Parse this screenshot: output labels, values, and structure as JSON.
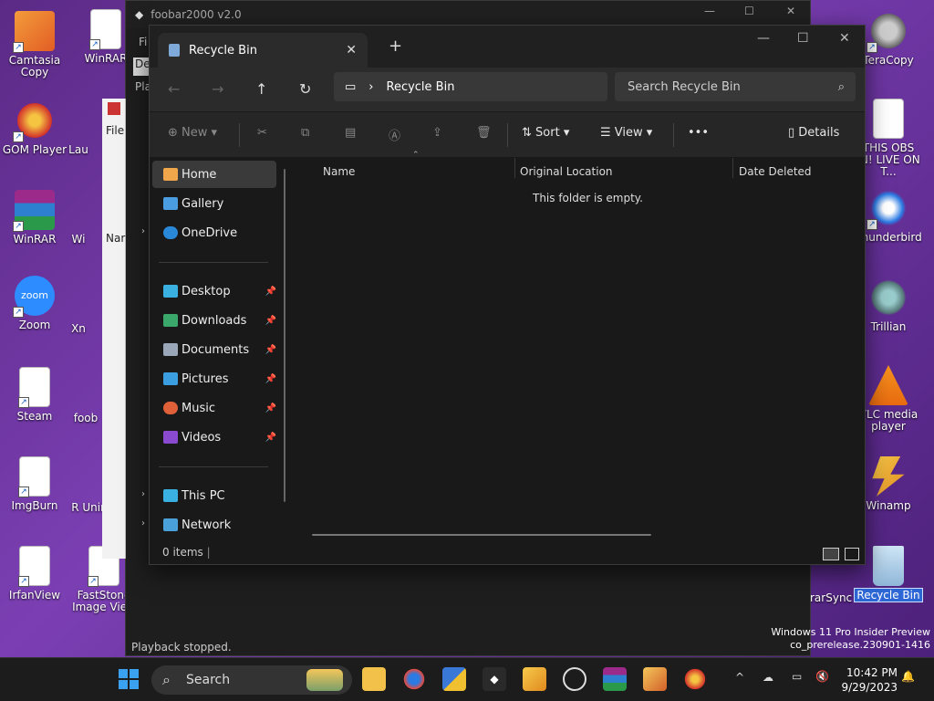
{
  "desktop": {
    "left_icons": [
      {
        "label": "Camtasia Copy",
        "icon": "camtasia-icon"
      },
      {
        "label": "GOM Player",
        "icon": "eye-icon"
      },
      {
        "label": "WinRAR",
        "icon": "winrar-icon"
      },
      {
        "label": "Zoom",
        "icon": "zoom-icon"
      },
      {
        "label": "Steam",
        "icon": "document-icon"
      },
      {
        "label": "ImgBurn",
        "icon": "document-icon"
      },
      {
        "label": "IrfanView",
        "icon": "document-icon"
      }
    ],
    "col2_icons": [
      {
        "label": "WinRAR"
      },
      {
        "label": "Lau"
      },
      {
        "label": "Wi"
      },
      {
        "label": "Xn"
      },
      {
        "label": "foob"
      },
      {
        "label": "R Unin"
      },
      {
        "label": "FastStone Image View"
      }
    ],
    "right_icons": [
      {
        "label": "TeraCopy",
        "icon": "teracopy-icon"
      },
      {
        "label": "THIS OBS IN! LIVE ON T...",
        "icon": "document-icon"
      },
      {
        "label": "Thunderbird",
        "icon": "thunderbird-icon"
      },
      {
        "label": "Trillian",
        "icon": "trillian-icon"
      },
      {
        "label": "VLC media player",
        "icon": "vlc-icon"
      },
      {
        "label": "Winamp",
        "icon": "winamp-icon"
      },
      {
        "label": "Recycle Bin",
        "icon": "recycle-bin-icon"
      }
    ],
    "partial_right": "rarSync",
    "watermark_line1": "Windows 11 Pro Insider Preview",
    "watermark_line2": "co_prerelease.230901-1416"
  },
  "foobar": {
    "title": "foobar2000 v2.0",
    "menu_partial": "Fi",
    "tab_partial": "Def",
    "pl_partial": "Pla",
    "status": "Playback stopped."
  },
  "explorer": {
    "tab_title": "Recycle Bin",
    "breadcrumb": "Recycle Bin",
    "search_placeholder": "Search Recycle Bin",
    "toolbar": {
      "new": "New",
      "sort": "Sort",
      "view": "View",
      "more": "•••",
      "details": "Details"
    },
    "nav": {
      "home": "Home",
      "gallery": "Gallery",
      "onedrive": "OneDrive",
      "desktop": "Desktop",
      "downloads": "Downloads",
      "documents": "Documents",
      "pictures": "Pictures",
      "music": "Music",
      "videos": "Videos",
      "thispc": "This PC",
      "network": "Network"
    },
    "columns": {
      "name": "Name",
      "original_location": "Original Location",
      "date_deleted": "Date Deleted"
    },
    "empty_message": "This folder is empty.",
    "status": "0 items"
  },
  "taskbar": {
    "search_label": "Search",
    "time": "10:42 PM",
    "date": "9/29/2023"
  },
  "colors": {
    "accent": "#2d67d6",
    "window_bg": "#191919",
    "desktop": "#6a35a0"
  }
}
